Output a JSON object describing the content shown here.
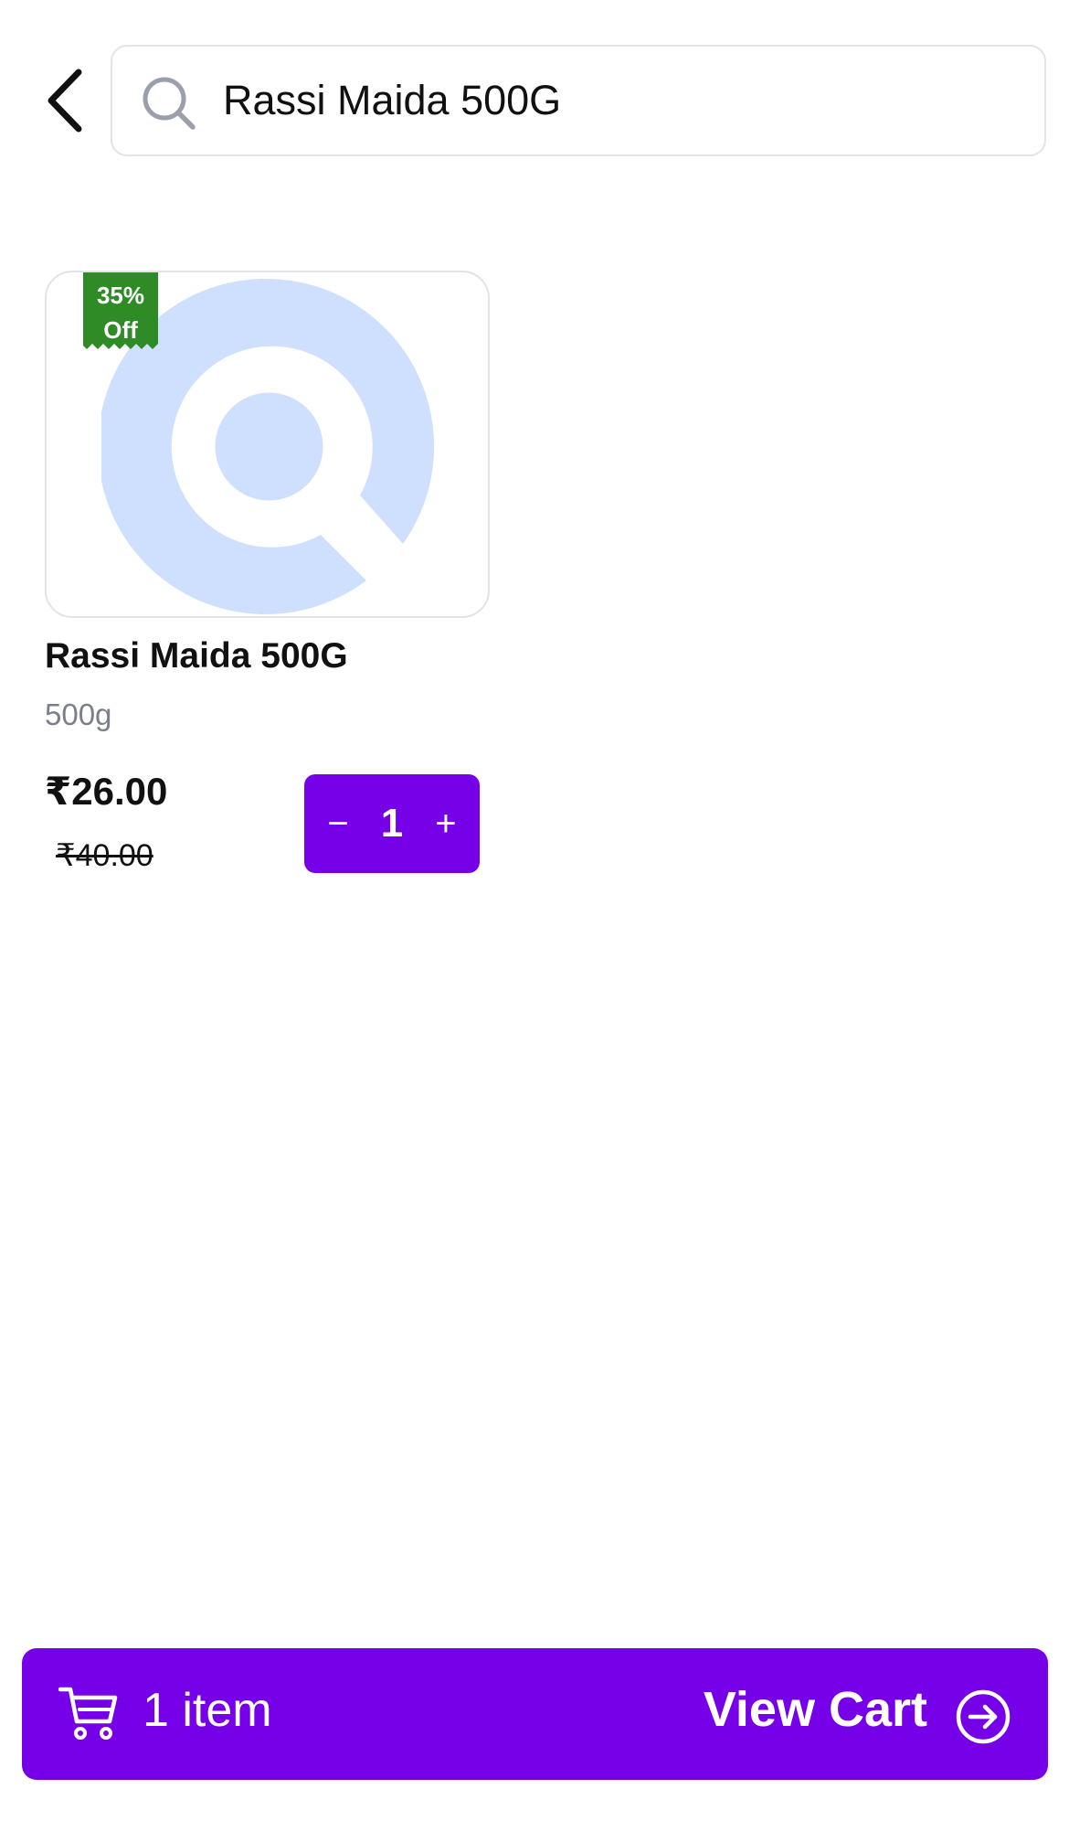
{
  "header": {
    "back_icon": "chevron-left-icon",
    "search": {
      "icon": "search-icon",
      "value": "Rassi Maida 500G",
      "placeholder": ""
    }
  },
  "products": [
    {
      "name": "Rassi Maida 500G",
      "weight": "500g",
      "price": "₹26.00",
      "original_price": "₹40.00",
      "discount_line1": "35%",
      "discount_line2": "Off",
      "image_icon": "placeholder-search-logo-icon",
      "quantity": "1",
      "decrement_label": "−",
      "increment_label": "+"
    }
  ],
  "cart_bar": {
    "icon": "cart-icon",
    "count_label": "1 item",
    "action_label": "View Cart",
    "action_icon": "arrow-right-circle-icon"
  },
  "colors": {
    "accent": "#7600e8",
    "discount_green": "#2e8b26",
    "placeholder_blue": "#cfe0ff",
    "muted_text": "#7a7f8c",
    "border": "#e3e4e8"
  }
}
